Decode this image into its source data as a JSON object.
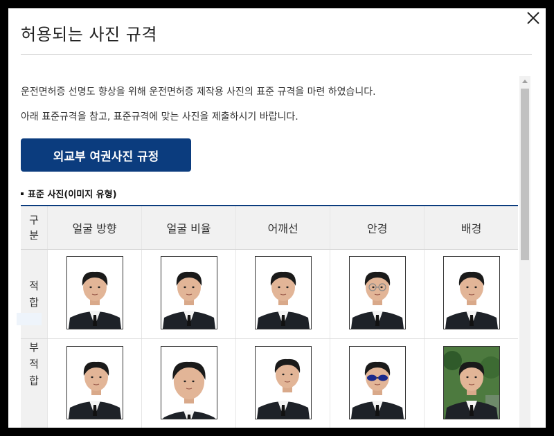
{
  "modal": {
    "title": "허용되는 사진 규격",
    "close_icon": "close-icon"
  },
  "content": {
    "paragraph1": "운전면허증 선명도 향상을 위해 운전면허증 제작용 사진의 표준 규격을 마련 하였습니다.",
    "paragraph2": "아래 표준규격을 참고, 표준규격에 맞는 사진을 제출하시기 바랍니다.",
    "button_label": "외교부 여권사진 규정",
    "section_label": "표준 사진(이미지 유형)"
  },
  "table": {
    "corner_header": "구\n분",
    "columns": [
      "얼굴 방향",
      "얼굴 비율",
      "어깨선",
      "안경",
      "배경"
    ],
    "rows": [
      {
        "label": "적\n합",
        "photos": [
          "suitable-face-direction",
          "suitable-face-ratio",
          "suitable-shoulder",
          "suitable-glasses",
          "suitable-background"
        ]
      },
      {
        "label": "부\n적\n합",
        "photos": [
          "unsuitable-face-direction",
          "unsuitable-face-ratio",
          "unsuitable-shoulder",
          "unsuitable-sunglasses",
          "unsuitable-background"
        ]
      }
    ]
  },
  "colors": {
    "accent": "#0b3c7e",
    "header_bg": "#f1f1f1"
  }
}
